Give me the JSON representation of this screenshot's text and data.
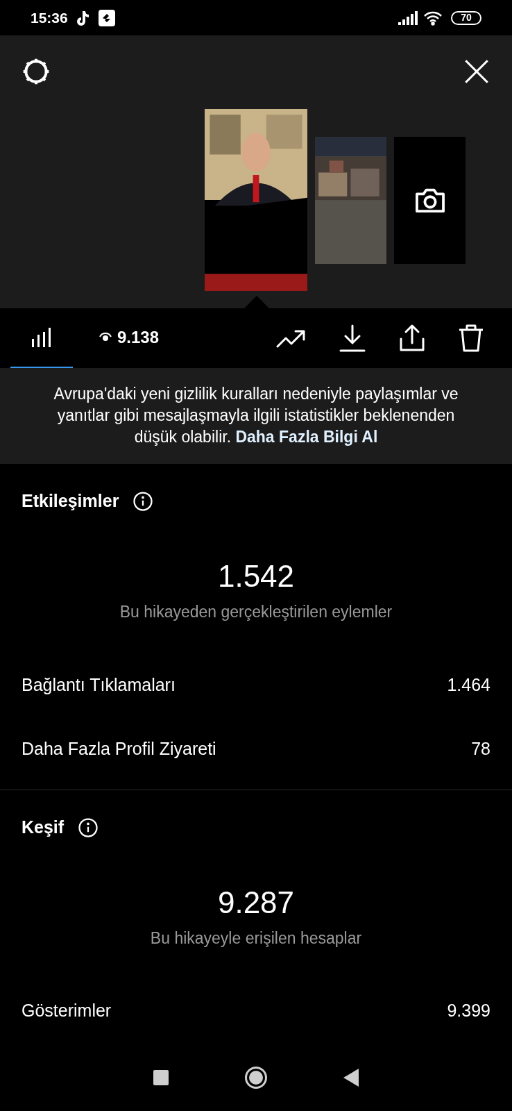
{
  "status_bar": {
    "time": "15:36",
    "battery": "70"
  },
  "stories": [
    {
      "kind": "picture",
      "selected": true
    },
    {
      "kind": "picture",
      "selected": false
    },
    {
      "kind": "camera",
      "selected": false
    }
  ],
  "tabs": [
    {
      "kind": "insights",
      "selected": true
    },
    {
      "kind": "views",
      "label": "9.138",
      "selected": false
    }
  ],
  "notice": {
    "text": "Avrupa'daki yeni gizlilik kuralları nedeniyle paylaşımlar ve yanıtlar gibi mesajlaşmayla ilgili istatistikler beklenenden düşük olabilir.",
    "link": "Daha Fazla Bilgi Al"
  },
  "sections": [
    {
      "title": "Etkileşimler",
      "total": "1.542",
      "caption": "Bu hikayeden gerçekleştirilen eylemler",
      "rows": [
        {
          "label": "Bağlantı Tıklamaları",
          "value": "1.464"
        },
        {
          "label": "Daha Fazla Profil Ziyareti",
          "value": "78"
        }
      ]
    },
    {
      "title": "Keşif",
      "total": "9.287",
      "caption": "Bu hikayeyle erişilen hesaplar",
      "rows": [
        {
          "label": "Gösterimler",
          "value": "9.399"
        }
      ]
    }
  ]
}
